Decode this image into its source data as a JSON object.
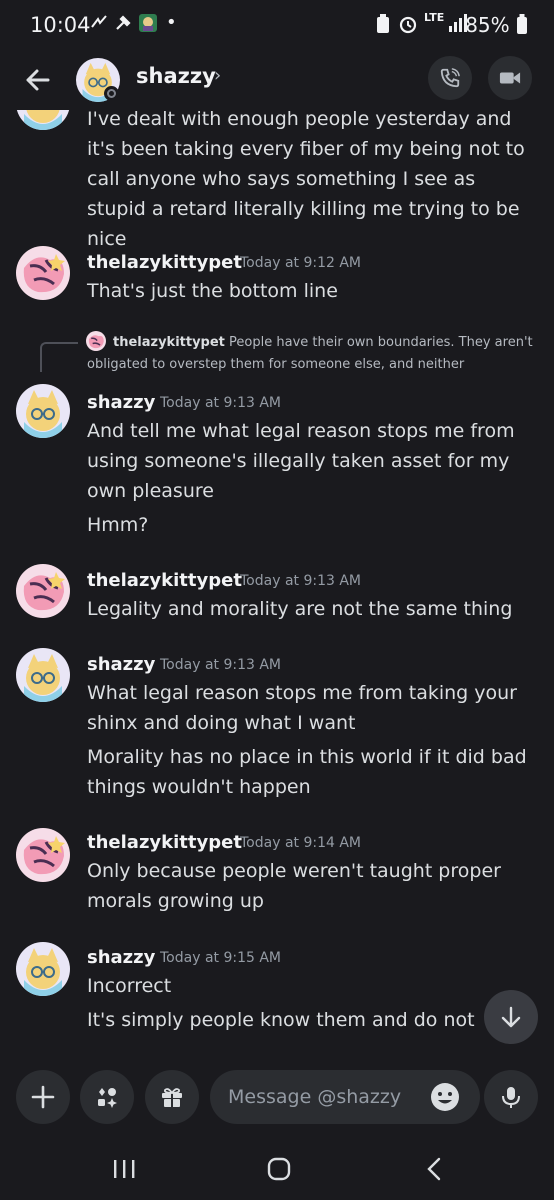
{
  "status_bar": {
    "time": "10:04",
    "battery": "85%",
    "network": "LTE"
  },
  "header": {
    "name": "shazzy",
    "chevron": "›"
  },
  "messages": [
    {
      "lines": "I've dealt with enough people yesterday and it's been taking every fiber of my being not to call anyone who says something I see as stupid a retard literally killing me trying to be nice"
    },
    {
      "author": "thelazykittypet",
      "time": "Today at 9:12 AM",
      "lines": [
        "That's just the bottom line"
      ]
    },
    {
      "reply": {
        "author": "thelazykittypet",
        "text": "People have their own boundaries. They aren't obligated to overstep them for someone else, and neither"
      },
      "author": "shazzy",
      "time": "Today at 9:13 AM",
      "lines": [
        "And tell me what legal reason stops me from using someone's illegally taken asset for my own pleasure",
        "Hmm?"
      ]
    },
    {
      "author": "thelazykittypet",
      "time": "Today at 9:13 AM",
      "lines": [
        "Legality and morality are not the same thing"
      ]
    },
    {
      "author": "shazzy",
      "time": "Today at 9:13 AM",
      "lines": [
        "What legal reason stops me from taking your shinx and doing what I want",
        "Morality has no place in this world if it did bad things wouldn't happen"
      ]
    },
    {
      "author": "thelazykittypet",
      "time": "Today at 9:14 AM",
      "lines": [
        "Only because people weren't taught proper morals growing up"
      ]
    },
    {
      "author": "shazzy",
      "time": "Today at 9:15 AM",
      "lines": [
        "Incorrect",
        "It's simply people know them and do not care"
      ]
    }
  ],
  "composer": {
    "placeholder": "Message @shazzy"
  },
  "icons": [
    "back-arrow-icon",
    "phone-icon",
    "video-icon",
    "plus-icon",
    "apps-icon",
    "gift-icon",
    "emoji-icon",
    "microphone-icon",
    "scroll-down-icon"
  ],
  "colors": {
    "background": "#1a1a1e",
    "button": "#2b2d31",
    "text": "#dbdee1",
    "muted": "#949ba4"
  }
}
